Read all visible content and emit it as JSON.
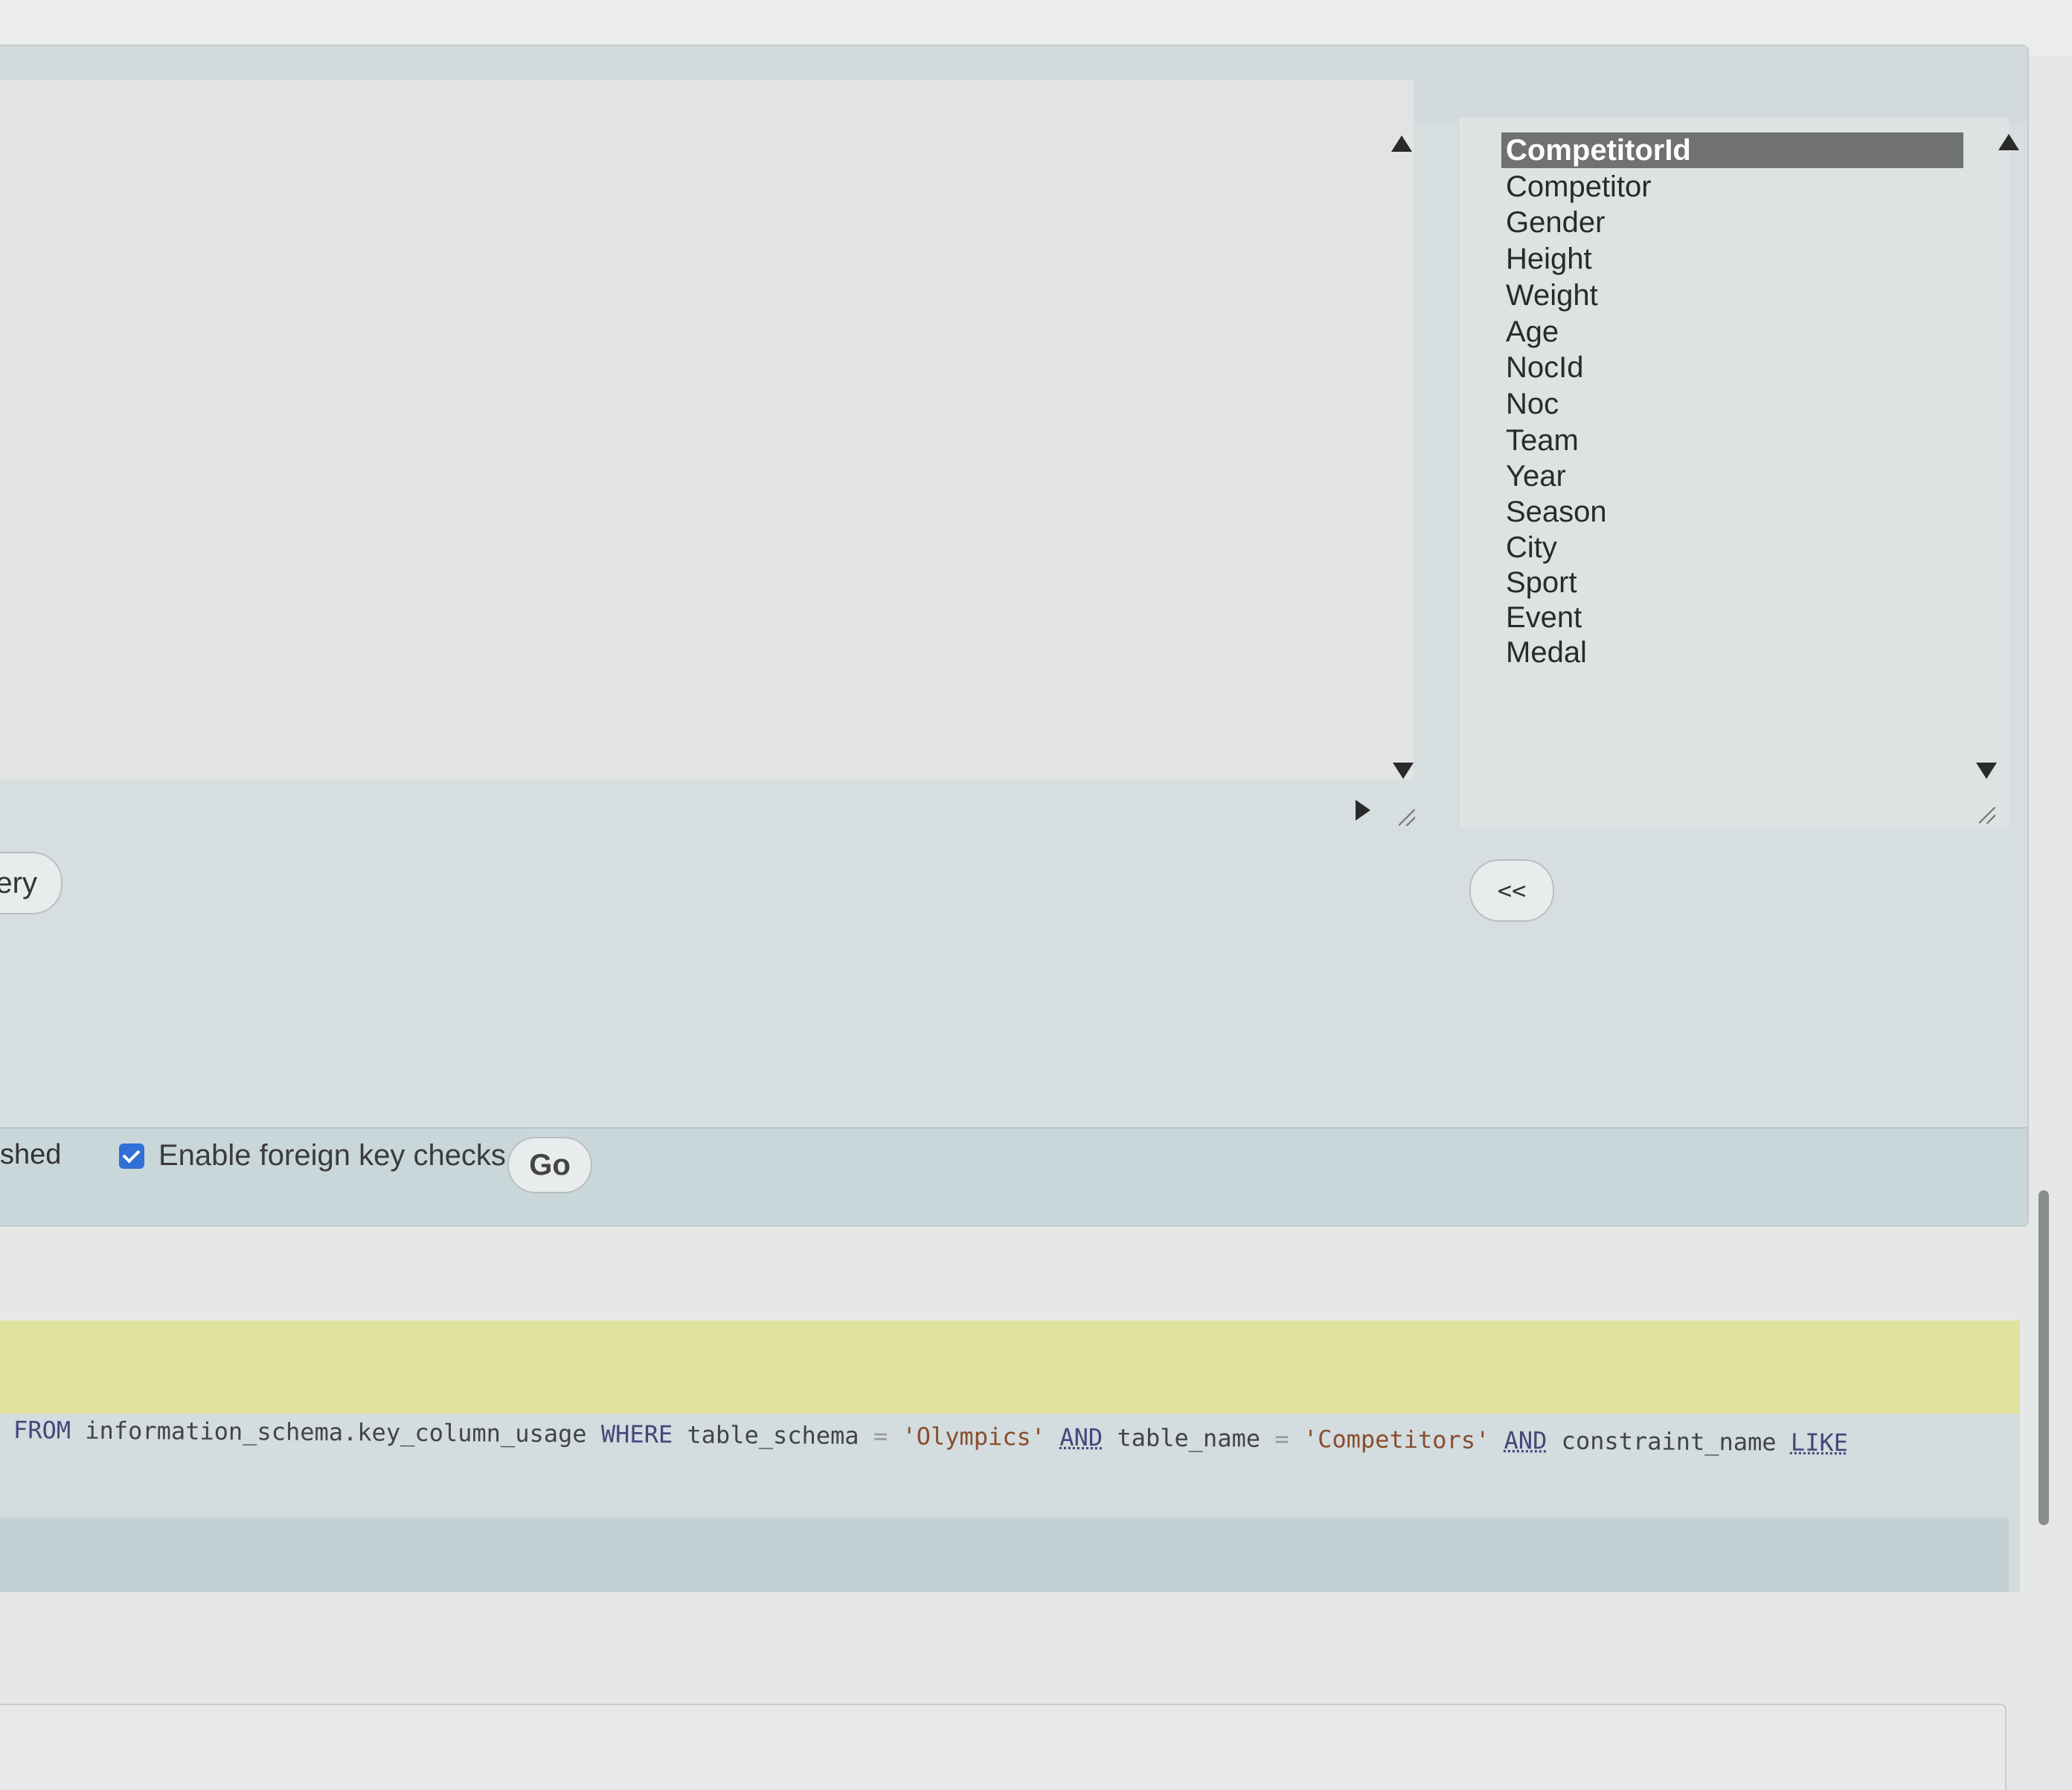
{
  "query_panel": {
    "query_button_label": "ery"
  },
  "columns_list": {
    "items": [
      "CompetitorId",
      "Competitor",
      "Gender",
      "Height",
      "Weight",
      "Age",
      "NocId",
      "Noc",
      "Team",
      "Year",
      "Season",
      "City",
      "Sport",
      "Event",
      "Medal"
    ],
    "selected": "CompetitorId"
  },
  "move_button": {
    "label": "<<"
  },
  "options_bar": {
    "left_label": "shed",
    "fk_checkbox_label": "Enable foreign key checks",
    "fk_checked": true,
    "go_label": "Go"
  },
  "sql": {
    "t1": "FROM",
    "t2": " information_schema.key_column_usage ",
    "t3": "WHERE",
    "t4": " table_schema ",
    "t5": "=",
    "t6": " 'Olympics' ",
    "t7": "AND",
    "t8": " table_name ",
    "t9": "=",
    "t10": " 'Competitors' ",
    "t11": "AND",
    "t12": " constraint_name ",
    "t13": "LIKE"
  },
  "colors": {
    "accent": "#2f6fd6",
    "highlight_row": "#dfe39b",
    "selected_item": "#6f7172"
  }
}
